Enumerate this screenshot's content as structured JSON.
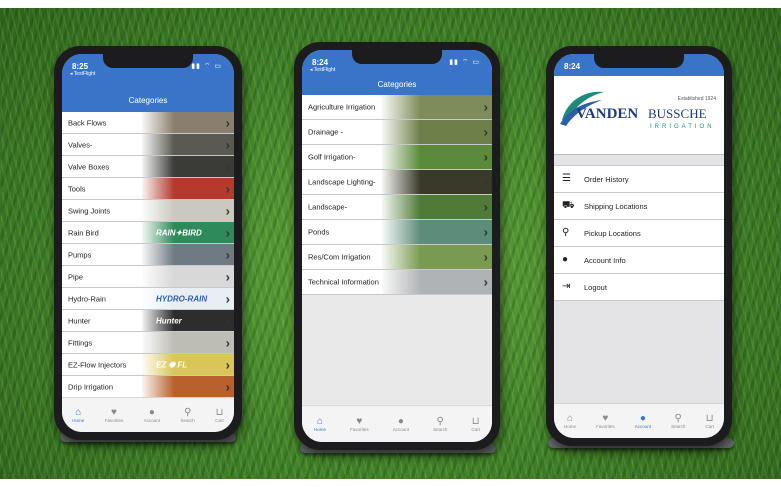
{
  "colors": {
    "accent": "#3a74c9",
    "grass": "#4b8a2e"
  },
  "phone1": {
    "time": "8:25",
    "carrier": "◂ TestFlight",
    "title": "Categories",
    "rows": [
      {
        "label": "Back Flows",
        "thumb": "#8a7f6e"
      },
      {
        "label": "Valves-",
        "thumb": "#5a5a52"
      },
      {
        "label": "Valve Boxes",
        "thumb": "#3b3b38"
      },
      {
        "label": "Tools",
        "thumb": "#b33a2c"
      },
      {
        "label": "Swing Joints",
        "thumb": "#c9c9c0"
      },
      {
        "label": "Rain Bird",
        "thumb": "#2e8a5a",
        "brand": "RAIN✦BIRD"
      },
      {
        "label": "Pumps",
        "thumb": "#707a82"
      },
      {
        "label": "Pipe",
        "thumb": "#d8d8d8"
      },
      {
        "label": "Hydro-Rain",
        "thumb": "#e8eef4",
        "brand": "HYDRO-RAIN"
      },
      {
        "label": "Hunter",
        "thumb": "#2d2d2d",
        "brand": "Hunter"
      },
      {
        "label": "Fittings",
        "thumb": "#bdbdb5"
      },
      {
        "label": "EZ-Flow Injectors",
        "thumb": "#d9c65a",
        "brand": "EZ ✺ FL"
      },
      {
        "label": "Drip Irrigation",
        "thumb": "#b8612c"
      }
    ],
    "tabs": [
      {
        "label": "Home",
        "icon": "home-icon",
        "glyph": "⌂",
        "active": true
      },
      {
        "label": "Favorites",
        "icon": "heart-icon",
        "glyph": "♥"
      },
      {
        "label": "Account",
        "icon": "user-icon",
        "glyph": "●"
      },
      {
        "label": "Search",
        "icon": "search-icon",
        "glyph": "⚲"
      },
      {
        "label": "Cart",
        "icon": "cart-icon",
        "glyph": "⊔"
      }
    ]
  },
  "phone2": {
    "time": "8:24",
    "carrier": "◂ TestFlight",
    "title": "Categories",
    "rows": [
      {
        "label": "Agriculture Irrigation",
        "thumb": "#7d8c5a"
      },
      {
        "label": "Drainage -",
        "thumb": "#6f7f4a"
      },
      {
        "label": "Golf Irrigation-",
        "thumb": "#5a8a3a"
      },
      {
        "label": "Landscape Lighting-",
        "thumb": "#3a3a2a"
      },
      {
        "label": "Landscape-",
        "thumb": "#4f7a38"
      },
      {
        "label": "Ponds",
        "thumb": "#5e8c7a"
      },
      {
        "label": "Res/Com Irrigation",
        "thumb": "#7a9a52"
      },
      {
        "label": "Technical Information",
        "thumb": "#b0b3b5"
      }
    ],
    "tabs": [
      {
        "label": "Home",
        "icon": "home-icon",
        "glyph": "⌂",
        "active": true
      },
      {
        "label": "Favorites",
        "icon": "heart-icon",
        "glyph": "♥"
      },
      {
        "label": "Account",
        "icon": "user-icon",
        "glyph": "●"
      },
      {
        "label": "Search",
        "icon": "search-icon",
        "glyph": "⚲"
      },
      {
        "label": "Cart",
        "icon": "cart-icon",
        "glyph": "⊔"
      }
    ]
  },
  "phone3": {
    "time": "8:24",
    "logo": {
      "name_left": "VANDEN",
      "name_right": "BUSSCHE",
      "sub": "IRRIGATION",
      "established": "Established 1924"
    },
    "menu": [
      {
        "label": "Order History",
        "icon": "list-icon",
        "glyph": "☰"
      },
      {
        "label": "Shipping Locations",
        "icon": "truck-icon",
        "glyph": "⛟"
      },
      {
        "label": "Pickup Locations",
        "icon": "map-pin-icon",
        "glyph": "⚲"
      },
      {
        "label": "Account Info",
        "icon": "user-icon",
        "glyph": "●"
      },
      {
        "label": "Logout",
        "icon": "logout-icon",
        "glyph": "⇥"
      }
    ],
    "tabs": [
      {
        "label": "Home",
        "icon": "home-icon",
        "glyph": "⌂"
      },
      {
        "label": "Favorites",
        "icon": "heart-icon",
        "glyph": "♥"
      },
      {
        "label": "Account",
        "icon": "user-icon",
        "glyph": "●",
        "active": true
      },
      {
        "label": "Search",
        "icon": "search-icon",
        "glyph": "⚲"
      },
      {
        "label": "Cart",
        "icon": "cart-icon",
        "glyph": "⊔"
      }
    ]
  }
}
